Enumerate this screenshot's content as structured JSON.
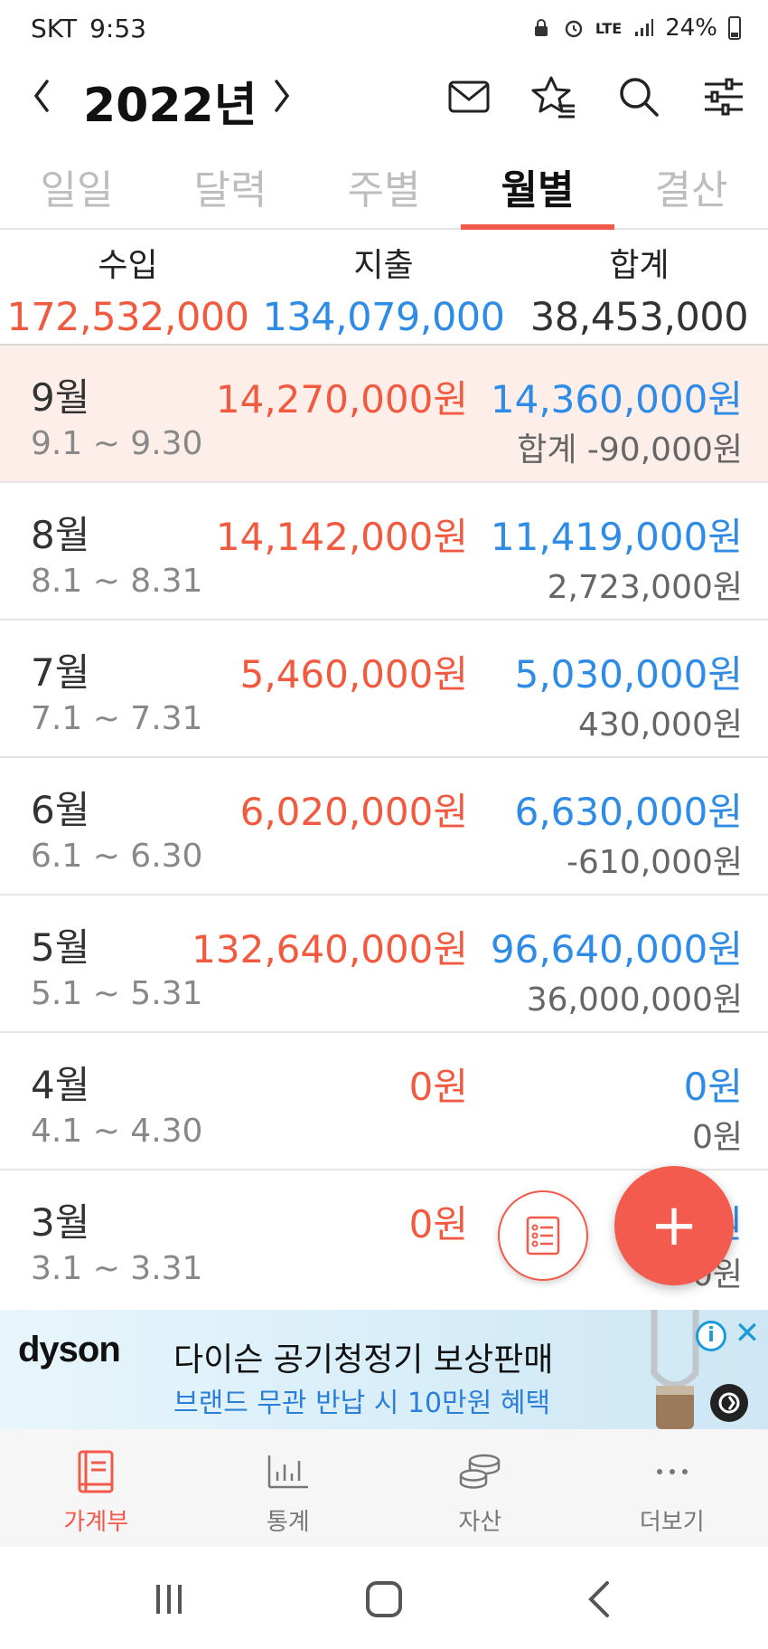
{
  "status_bar": {
    "carrier": "SKT",
    "time": "9:53",
    "network": "LTE",
    "battery": "24%"
  },
  "header": {
    "year": "2022년",
    "icons": [
      "prev-arrow-icon",
      "next-arrow-icon",
      "mail-icon",
      "star-list-icon",
      "search-icon",
      "filter-sliders-icon"
    ]
  },
  "tabs": [
    {
      "label": "일일"
    },
    {
      "label": "달력"
    },
    {
      "label": "주별"
    },
    {
      "label": "월별",
      "active": true
    },
    {
      "label": "결산"
    }
  ],
  "summary": {
    "income_label": "수입",
    "expense_label": "지출",
    "total_label": "합계",
    "income": "172,532,000",
    "expense": "134,079,000",
    "total": "38,453,000"
  },
  "months": [
    {
      "name": "9월",
      "range": "9.1 ~ 9.30",
      "income": "14,270,000원",
      "expense": "14,360,000원",
      "total": "합계 -90,000원",
      "current": true
    },
    {
      "name": "8월",
      "range": "8.1 ~ 8.31",
      "income": "14,142,000원",
      "expense": "11,419,000원",
      "total": "2,723,000원"
    },
    {
      "name": "7월",
      "range": "7.1 ~ 7.31",
      "income": "5,460,000원",
      "expense": "5,030,000원",
      "total": "430,000원"
    },
    {
      "name": "6월",
      "range": "6.1 ~ 6.30",
      "income": "6,020,000원",
      "expense": "6,630,000원",
      "total": "-610,000원"
    },
    {
      "name": "5월",
      "range": "5.1 ~ 5.31",
      "income": "132,640,000원",
      "expense": "96,640,000원",
      "total": "36,000,000원"
    },
    {
      "name": "4월",
      "range": "4.1 ~ 4.30",
      "income": "0원",
      "expense": "0원",
      "total": "0원"
    },
    {
      "name": "3월",
      "range": "3.1 ~ 3.31",
      "income": "0원",
      "expense": "0원",
      "total": "0원"
    }
  ],
  "fab": {
    "add_symbol": "+"
  },
  "ad": {
    "brand": "dyson",
    "title": "다이슨 공기청정기 보상판매",
    "subtitle": "브랜드 무관 반납 시 10만원 혜택",
    "info_symbol": "i",
    "close_symbol": "✕"
  },
  "bottom_nav": [
    {
      "label": "가계부",
      "icon": "book-icon",
      "active": true
    },
    {
      "label": "통계",
      "icon": "bar-chart-icon"
    },
    {
      "label": "자산",
      "icon": "coins-icon"
    },
    {
      "label": "더보기",
      "icon": "more-dots-icon"
    }
  ],
  "colors": {
    "income": "#f15a3f",
    "expense": "#2e8be6",
    "accent": "#f15a4a",
    "current_row_bg": "#fdeeea"
  }
}
